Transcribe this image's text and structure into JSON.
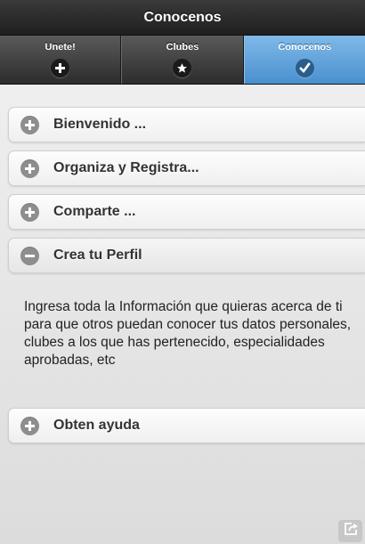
{
  "header": {
    "title": "Conocenos"
  },
  "tabs": [
    {
      "label": "Unete!",
      "icon": "plus-icon",
      "active": false
    },
    {
      "label": "Clubes",
      "icon": "star-icon",
      "active": false
    },
    {
      "label": "Conocenos",
      "icon": "check-icon",
      "active": true
    }
  ],
  "collapsibles": [
    {
      "title": "Bienvenido ...",
      "expanded": false
    },
    {
      "title": "Organiza y Registra...",
      "expanded": false
    },
    {
      "title": "Comparte ...",
      "expanded": false
    },
    {
      "title": "Crea tu Perfil",
      "expanded": true,
      "body": "Ingresa toda la Información que quieras acerca de ti para que otros puedan conocer tus datos personales, clubes a los que has pertenecido, especialidades aprobadas, etc"
    },
    {
      "title": "Obten ayuda",
      "expanded": false
    }
  ],
  "colors": {
    "active_tab": "#4a90cf",
    "header": "#1f1f1f"
  }
}
